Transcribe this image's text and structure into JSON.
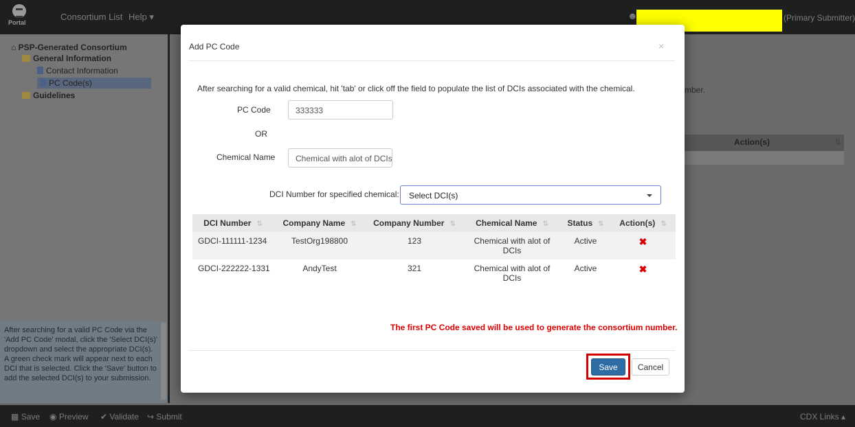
{
  "topbar": {
    "logo_text": "Portal",
    "nav": [
      "Consortium List",
      "Help ▾"
    ],
    "user_suffix": "(Primary Submitter)"
  },
  "sidebar": {
    "root": "PSP-Generated Consortium",
    "general": "General Information",
    "contact": "Contact Information",
    "pccodes": "PC Code(s)",
    "guidelines": "Guidelines",
    "help_text": "After searching for a valid PC Code via the 'Add PC Code' modal, click the 'Select DCI(s)' dropdown and select the appropriate DCI(s). A green check mark will appear next to each DCI that is selected. Click the 'Save' button to add the selected DCI(s) to your submission."
  },
  "background": {
    "partial_text": "mber.",
    "actions_header": "Action(s)"
  },
  "modal": {
    "title": "Add PC Code",
    "close": "×",
    "instructions": "After searching for a valid chemical, hit 'tab' or click off the field to populate the list of DCIs associated with the chemical.",
    "pc_code_label": "PC Code",
    "pc_code_value": "333333",
    "or_label": "OR",
    "chem_label": "Chemical Name",
    "chem_value": "Chemical with alot of DCIs",
    "dci_label": "DCI Number for specified chemical:",
    "dci_select": "Select DCI(s)",
    "table": {
      "headers": [
        "DCI Number",
        "Company Name",
        "Company Number",
        "Chemical Name",
        "Status",
        "Action(s)"
      ],
      "rows": [
        [
          "GDCI-111111-1234",
          "TestOrg198800",
          "123",
          "Chemical with alot of DCIs",
          "Active"
        ],
        [
          "GDCI-222222-1331",
          "AndyTest",
          "321",
          "Chemical with alot of DCIs",
          "Active"
        ]
      ]
    },
    "warning": "The first PC Code saved will be used to generate the consortium number.",
    "save": "Save",
    "cancel": "Cancel"
  },
  "bottombar": {
    "save": "Save",
    "preview": "Preview",
    "validate": "Validate",
    "submit": "Submit",
    "cdx": "CDX Links ▴"
  }
}
